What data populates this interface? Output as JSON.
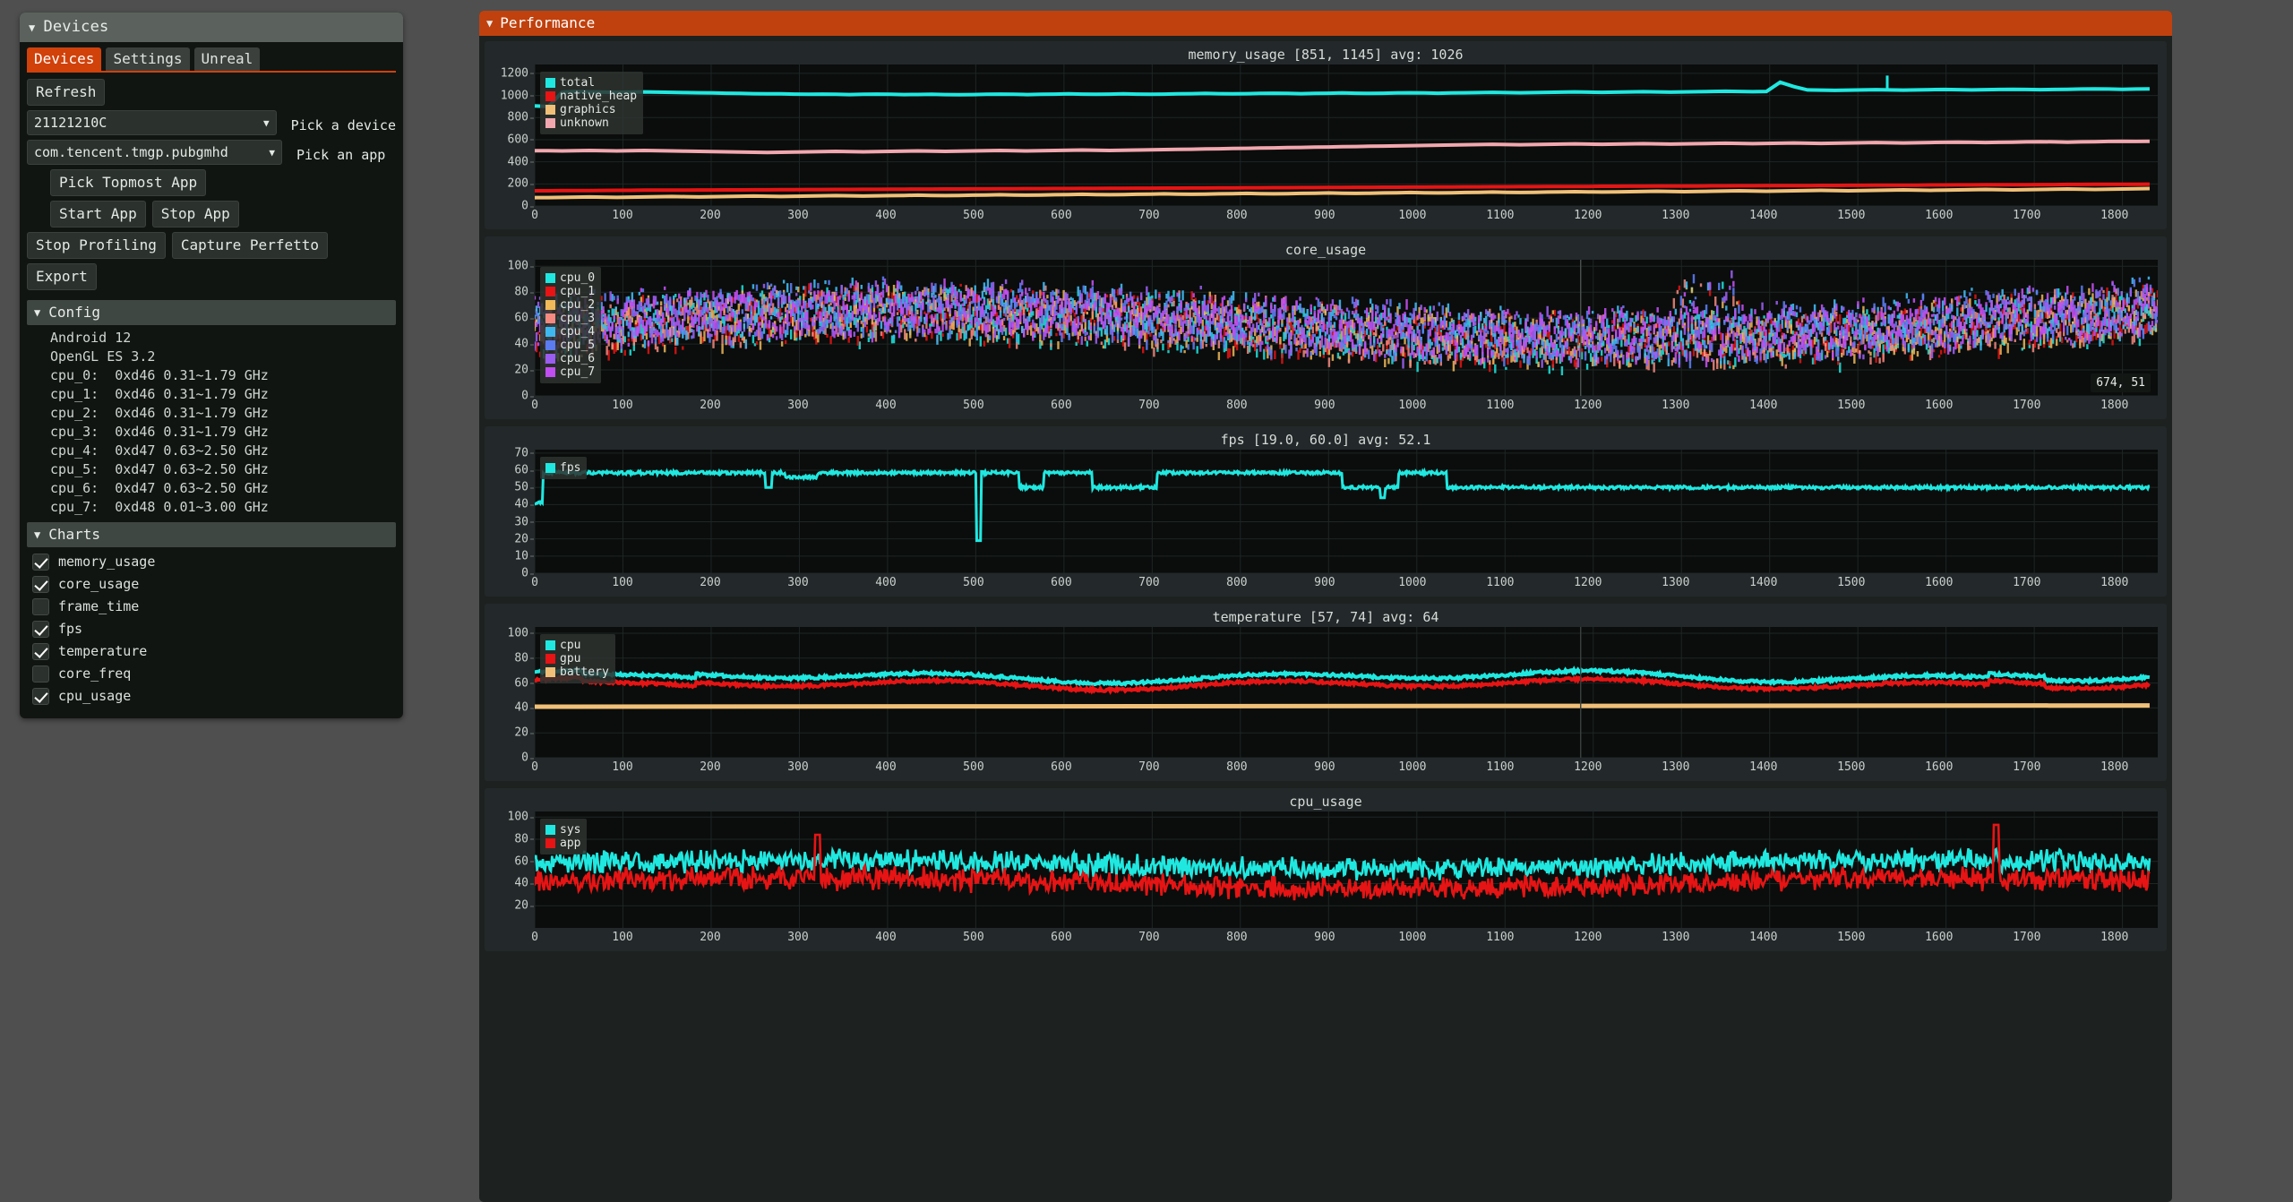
{
  "devices_window": {
    "title": "Devices",
    "caret": "▼",
    "tabs": [
      {
        "label": "Devices",
        "active": true
      },
      {
        "label": "Settings",
        "active": false
      },
      {
        "label": "Unreal",
        "active": false
      }
    ],
    "refresh_label": "Refresh",
    "device_select": {
      "value": "21121210C",
      "caret": "▼",
      "label": "Pick a device"
    },
    "app_select": {
      "value": "com.tencent.tmgp.pubgmhd",
      "caret": "▼",
      "label": "Pick an app"
    },
    "pick_topmost_label": "Pick Topmost App",
    "start_app_label": "Start App",
    "stop_app_label": "Stop App",
    "stop_profiling_label": "Stop Profiling",
    "capture_perfetto_label": "Capture Perfetto",
    "export_label": "Export",
    "config": {
      "title": "Config",
      "caret": "▼",
      "lines": [
        "Android 12",
        "OpenGL ES 3.2",
        "cpu_0:  0xd46 0.31~1.79 GHz",
        "cpu_1:  0xd46 0.31~1.79 GHz",
        "cpu_2:  0xd46 0.31~1.79 GHz",
        "cpu_3:  0xd46 0.31~1.79 GHz",
        "cpu_4:  0xd47 0.63~2.50 GHz",
        "cpu_5:  0xd47 0.63~2.50 GHz",
        "cpu_6:  0xd47 0.63~2.50 GHz",
        "cpu_7:  0xd48 0.01~3.00 GHz"
      ]
    },
    "charts": {
      "title": "Charts",
      "caret": "▼",
      "items": [
        {
          "label": "memory_usage",
          "checked": true
        },
        {
          "label": "core_usage",
          "checked": true
        },
        {
          "label": "frame_time",
          "checked": false
        },
        {
          "label": "fps",
          "checked": true
        },
        {
          "label": "temperature",
          "checked": true
        },
        {
          "label": "core_freq",
          "checked": false
        },
        {
          "label": "cpu_usage",
          "checked": true
        }
      ]
    }
  },
  "performance_window": {
    "title": "Performance",
    "caret": "▼",
    "accent_color": "#c0410d"
  },
  "chart_data": [
    {
      "type": "line",
      "name": "memory_usage",
      "title": "memory_usage [851, 1145] avg: 1026",
      "xlabel": "",
      "ylabel": "",
      "xlim": [
        0,
        1840
      ],
      "ylim": [
        0,
        1280
      ],
      "xticks": [
        0,
        100,
        200,
        300,
        400,
        500,
        600,
        700,
        800,
        900,
        1000,
        1100,
        1200,
        1300,
        1400,
        1500,
        1600,
        1700,
        1800
      ],
      "yticks": [
        0,
        200,
        400,
        600,
        800,
        1000,
        1200
      ],
      "grid": true,
      "legend_position": "top-left",
      "series": [
        {
          "name": "total",
          "color": "#20e8e0",
          "values": [
            905,
            900,
            1030,
            1035,
            1032,
            1030,
            1028,
            1030,
            1032,
            1030,
            1028,
            1026,
            1024,
            1022,
            1020,
            1018,
            1016,
            1014,
            1015,
            1012,
            1010,
            1012,
            1010,
            1008,
            1010,
            1012,
            1010,
            1008,
            1009,
            1010,
            1008,
            1006,
            1008,
            1010,
            1012,
            1010,
            1008,
            1010,
            1012,
            1014,
            1012,
            1010,
            1012,
            1014,
            1012,
            1010,
            1012,
            1014,
            1016,
            1018,
            1016,
            1014,
            1016,
            1018,
            1020,
            1018,
            1016,
            1018,
            1020,
            1022,
            1020,
            1018,
            1020,
            1022,
            1024,
            1022,
            1020,
            1022,
            1024,
            1026,
            1028,
            1026,
            1024,
            1026,
            1028,
            1030,
            1032,
            1030,
            1028,
            1030,
            1032,
            1034,
            1032,
            1030,
            1032,
            1034,
            1036,
            1038,
            1036,
            1034,
            1036,
            1120,
            1080,
            1050,
            1048,
            1046,
            1048,
            1050,
            1052,
            1050,
            1048,
            1050,
            1052,
            1054,
            1052,
            1050,
            1052,
            1054,
            1056,
            1054,
            1052,
            1054,
            1056,
            1058,
            1060,
            1058,
            1056,
            1058,
            1060
          ]
        },
        {
          "name": "native_heap",
          "color": "#e61414",
          "values": [
            138,
            138,
            139,
            140,
            140,
            141,
            142,
            142,
            143,
            143,
            144,
            144,
            145,
            145,
            146,
            146,
            147,
            147,
            148,
            148,
            149,
            149,
            150,
            150,
            151,
            151,
            152,
            152,
            153,
            153,
            154,
            154,
            155,
            155,
            156,
            156,
            157,
            157,
            158,
            158,
            159,
            159,
            160,
            160,
            161,
            161,
            162,
            162,
            163,
            163,
            164,
            164,
            165,
            165,
            166,
            166,
            167,
            167,
            168,
            168,
            169,
            169,
            170,
            170,
            171,
            171,
            172,
            172,
            173,
            173,
            174,
            174,
            175,
            175,
            176,
            176,
            177,
            177,
            178,
            178,
            179,
            179,
            180,
            180,
            181,
            181,
            182,
            182,
            183,
            183,
            184,
            184,
            185,
            185,
            186,
            186,
            187,
            187,
            188,
            188,
            189,
            189,
            190,
            190,
            191,
            191,
            192,
            192,
            193,
            193,
            194,
            194,
            195,
            195,
            196,
            196,
            197,
            197,
            198
          ]
        },
        {
          "name": "graphics",
          "color": "#f0c078",
          "values": [
            76,
            76,
            78,
            80,
            82,
            80,
            78,
            80,
            82,
            84,
            86,
            84,
            82,
            84,
            86,
            88,
            90,
            88,
            86,
            88,
            90,
            92,
            94,
            92,
            90,
            92,
            94,
            96,
            98,
            96,
            94,
            96,
            98,
            100,
            102,
            100,
            98,
            100,
            102,
            104,
            106,
            104,
            102,
            104,
            106,
            108,
            110,
            108,
            106,
            108,
            110,
            112,
            114,
            112,
            110,
            112,
            114,
            116,
            118,
            116,
            114,
            116,
            118,
            120,
            122,
            120,
            118,
            120,
            122,
            124,
            126,
            124,
            122,
            124,
            126,
            128,
            130,
            128,
            126,
            128,
            130,
            132,
            134,
            132,
            130,
            132,
            134,
            136,
            138,
            136,
            134,
            136,
            138,
            140,
            142,
            140,
            138,
            140,
            142,
            144,
            146,
            144,
            142,
            144,
            146,
            148,
            150,
            148,
            146,
            148,
            150,
            152,
            154,
            152,
            150,
            152,
            154,
            156,
            158
          ]
        },
        {
          "name": "unknown",
          "color": "#f2a7ae",
          "values": [
            500,
            500,
            498,
            500,
            502,
            500,
            498,
            500,
            502,
            500,
            498,
            496,
            494,
            492,
            490,
            488,
            486,
            484,
            486,
            488,
            490,
            492,
            494,
            492,
            490,
            492,
            494,
            496,
            498,
            496,
            494,
            496,
            498,
            500,
            502,
            500,
            498,
            500,
            502,
            504,
            506,
            504,
            502,
            504,
            506,
            508,
            510,
            512,
            514,
            516,
            518,
            520,
            522,
            524,
            526,
            528,
            530,
            532,
            534,
            536,
            538,
            540,
            542,
            544,
            546,
            548,
            550,
            552,
            554,
            556,
            558,
            556,
            554,
            556,
            558,
            560,
            562,
            560,
            558,
            560,
            562,
            564,
            562,
            560,
            562,
            564,
            566,
            568,
            566,
            564,
            566,
            568,
            570,
            568,
            566,
            568,
            570,
            572,
            574,
            572,
            570,
            572,
            574,
            576,
            578,
            576,
            574,
            576,
            578,
            580,
            582,
            580,
            578,
            580,
            582,
            584,
            586,
            584,
            586
          ]
        }
      ]
    },
    {
      "type": "scatter",
      "name": "core_usage",
      "title": "core_usage",
      "xlim": [
        0,
        1840
      ],
      "ylim": [
        0,
        105
      ],
      "xticks": [
        0,
        100,
        200,
        300,
        400,
        500,
        600,
        700,
        800,
        900,
        1000,
        1100,
        1200,
        1300,
        1400,
        1500,
        1600,
        1700,
        1800
      ],
      "yticks": [
        0,
        20,
        40,
        60,
        80,
        100
      ],
      "grid": true,
      "legend_position": "top-left",
      "cursor_readout": "674, 51",
      "series": [
        {
          "name": "cpu_0",
          "color": "#20e8e0"
        },
        {
          "name": "cpu_1",
          "color": "#e61414"
        },
        {
          "name": "cpu_2",
          "color": "#f0b959"
        },
        {
          "name": "cpu_3",
          "color": "#f58a80"
        },
        {
          "name": "cpu_4",
          "color": "#3fb8f0"
        },
        {
          "name": "cpu_5",
          "color": "#5b7bf0"
        },
        {
          "name": "cpu_6",
          "color": "#9b5cf0"
        },
        {
          "name": "cpu_7",
          "color": "#c14ef0"
        }
      ]
    },
    {
      "type": "line",
      "name": "fps",
      "title": "fps [19.0, 60.0] avg: 52.1",
      "xlim": [
        0,
        1840
      ],
      "ylim": [
        0,
        72
      ],
      "xticks": [
        0,
        100,
        200,
        300,
        400,
        500,
        600,
        700,
        800,
        900,
        1000,
        1100,
        1200,
        1300,
        1400,
        1500,
        1600,
        1700,
        1800
      ],
      "yticks": [
        0,
        10,
        20,
        30,
        40,
        50,
        60,
        70
      ],
      "grid": true,
      "legend_position": "top-left",
      "series": [
        {
          "name": "fps",
          "color": "#20e8e0",
          "min": 19.0,
          "max": 60.0,
          "avg": 52.1
        }
      ]
    },
    {
      "type": "line",
      "name": "temperature",
      "title": "temperature [57, 74] avg: 64",
      "xlim": [
        0,
        1840
      ],
      "ylim": [
        0,
        105
      ],
      "xticks": [
        0,
        100,
        200,
        300,
        400,
        500,
        600,
        700,
        800,
        900,
        1000,
        1100,
        1200,
        1300,
        1400,
        1500,
        1600,
        1700,
        1800
      ],
      "yticks": [
        0,
        20,
        40,
        60,
        80,
        100
      ],
      "grid": true,
      "legend_position": "top-left",
      "series": [
        {
          "name": "cpu",
          "color": "#20e8e0"
        },
        {
          "name": "gpu",
          "color": "#e61414"
        },
        {
          "name": "battery",
          "color": "#f0c078"
        }
      ]
    },
    {
      "type": "line",
      "name": "cpu_usage",
      "title": "cpu_usage",
      "xlim": [
        0,
        1840
      ],
      "ylim": [
        0,
        105
      ],
      "xticks": [
        0,
        100,
        200,
        300,
        400,
        500,
        600,
        700,
        800,
        900,
        1000,
        1100,
        1200,
        1300,
        1400,
        1500,
        1600,
        1700,
        1800
      ],
      "yticks": [
        20,
        40,
        60,
        80,
        100
      ],
      "grid": true,
      "legend_position": "top-left",
      "series": [
        {
          "name": "sys",
          "color": "#20e8e0"
        },
        {
          "name": "app",
          "color": "#e61414"
        }
      ]
    }
  ]
}
